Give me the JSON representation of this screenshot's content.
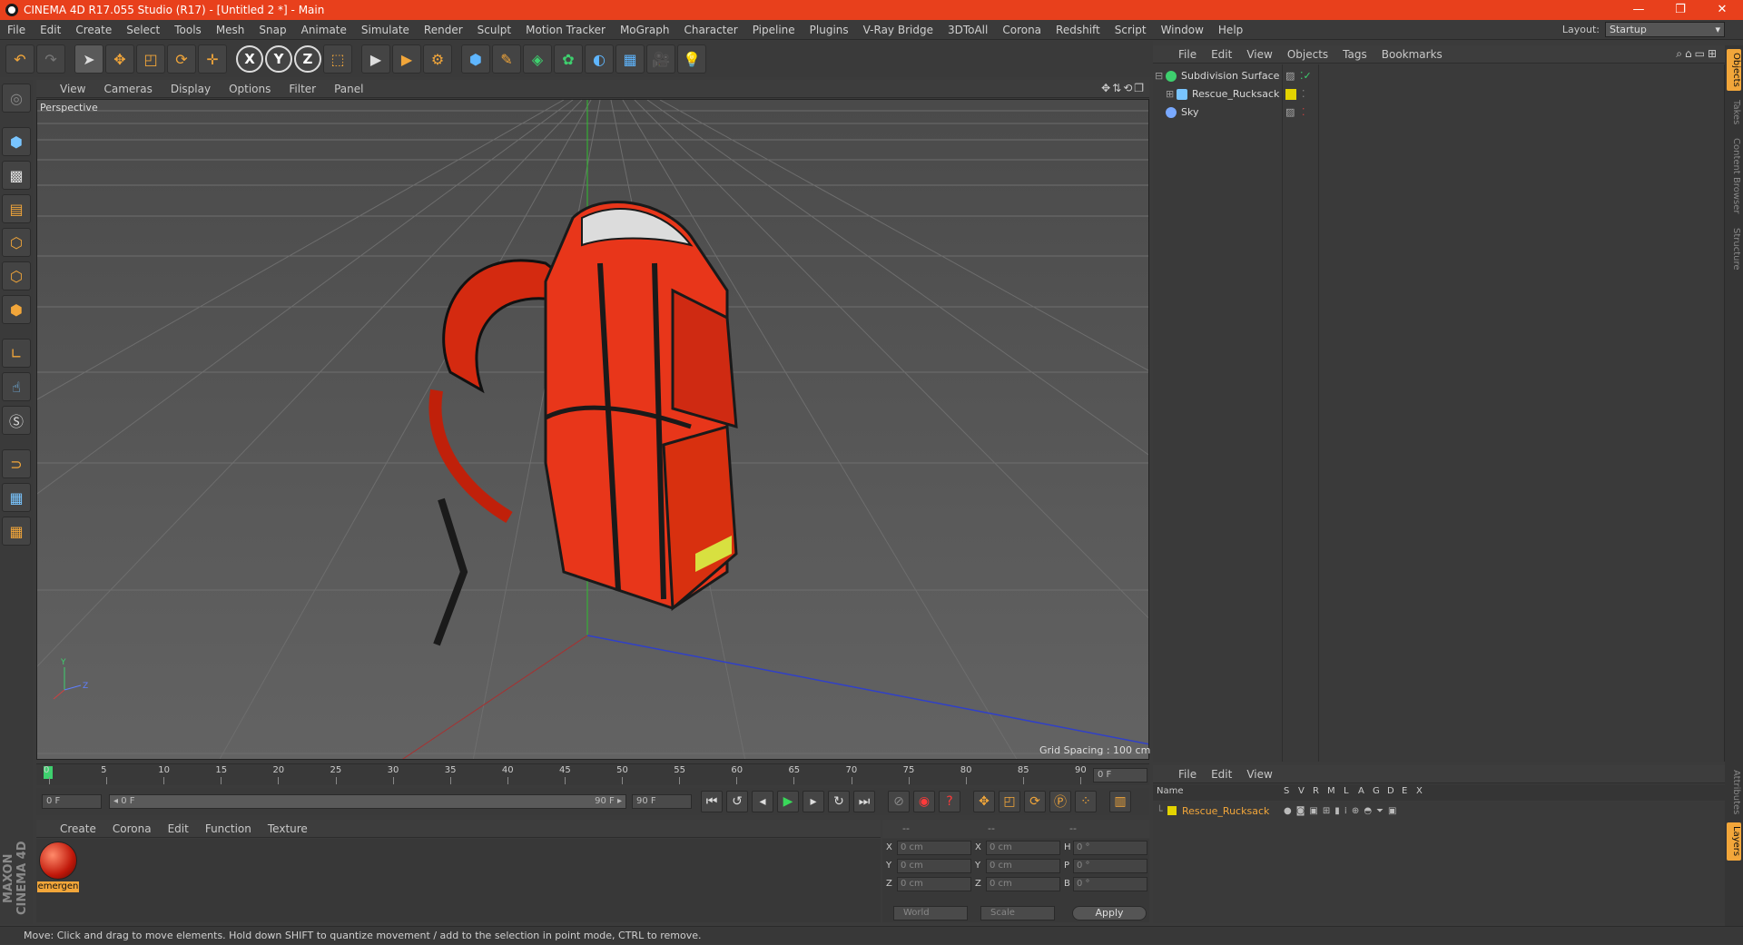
{
  "window": {
    "title": "CINEMA 4D R17.055 Studio (R17) - [Untitled 2 *] - Main",
    "controls": [
      "—",
      "❐",
      "✕"
    ]
  },
  "menubar": {
    "items": [
      "File",
      "Edit",
      "Create",
      "Select",
      "Tools",
      "Mesh",
      "Snap",
      "Animate",
      "Simulate",
      "Render",
      "Sculpt",
      "Motion Tracker",
      "MoGraph",
      "Character",
      "Pipeline",
      "Plugins",
      "V-Ray Bridge",
      "3DToAll",
      "Corona",
      "Redshift",
      "Script",
      "Window",
      "Help"
    ],
    "layout_label": "Layout:",
    "layout_value": "Startup"
  },
  "viewport": {
    "menu": [
      "View",
      "Cameras",
      "Display",
      "Options",
      "Filter",
      "Panel"
    ],
    "label": "Perspective",
    "grid_spacing": "Grid Spacing : 100 cm",
    "axis_labels": {
      "y": "Y",
      "z": "Z"
    }
  },
  "timeline": {
    "ticks": [
      "0",
      "5",
      "10",
      "15",
      "20",
      "25",
      "30",
      "35",
      "40",
      "45",
      "50",
      "55",
      "60",
      "65",
      "70",
      "75",
      "80",
      "85",
      "90"
    ],
    "current_frame": "0 F",
    "start_field": "0 F",
    "range_start": "◂ 0 F",
    "range_end": "90 F ▸",
    "end_field": "90 F",
    "frame_field": "0 F"
  },
  "material_manager": {
    "menu": [
      "Create",
      "Corona",
      "Edit",
      "Function",
      "Texture"
    ],
    "material_name": "emergen"
  },
  "coordinates": {
    "header": [
      "--",
      "--",
      "--"
    ],
    "rows": [
      {
        "a": "X",
        "av": "0 cm",
        "b": "X",
        "bv": "0 cm",
        "c": "H",
        "cv": "0 °"
      },
      {
        "a": "Y",
        "av": "0 cm",
        "b": "Y",
        "bv": "0 cm",
        "c": "P",
        "cv": "0 °"
      },
      {
        "a": "Z",
        "av": "0 cm",
        "b": "Z",
        "bv": "0 cm",
        "c": "B",
        "cv": "0 °"
      }
    ],
    "world": "World",
    "scale": "Scale",
    "apply": "Apply"
  },
  "object_manager": {
    "menu": [
      "File",
      "Edit",
      "View",
      "Objects",
      "Tags",
      "Bookmarks"
    ],
    "objects": [
      {
        "name": "Subdivision Surface",
        "icon_color": "#3ed06e"
      },
      {
        "name": "Rescue_Rucksack",
        "icon_color": "#79c5ff"
      },
      {
        "name": "Sky",
        "icon_color": "#79a9ff"
      }
    ]
  },
  "right_tabs": [
    "Objects",
    "Takes",
    "Content Browser",
    "Structure",
    "Attributes",
    "Layers"
  ],
  "layer_manager": {
    "menu": [
      "File",
      "Edit",
      "View"
    ],
    "columns": [
      "Name",
      "S",
      "V",
      "R",
      "M",
      "L",
      "A",
      "G",
      "D",
      "E",
      "X"
    ],
    "layers": [
      {
        "name": "Rescue_Rucksack",
        "color": "#e3d300"
      }
    ]
  },
  "branding": {
    "text": "MAXON CINEMA 4D"
  },
  "status_bar": "Move: Click and drag to move elements. Hold down SHIFT to quantize movement / add to the selection in point mode, CTRL to remove.",
  "colors": {
    "accent": "#f2a63a",
    "titlebar": "#e8401c",
    "layer_name": "#f2a63a"
  }
}
